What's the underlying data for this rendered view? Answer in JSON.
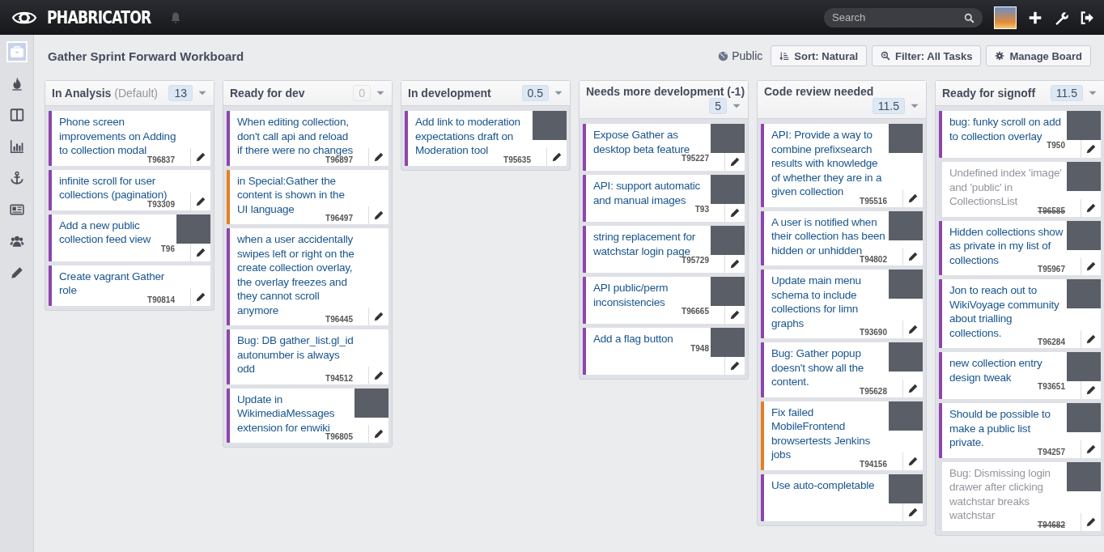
{
  "topbar": {
    "logo": "PHABRICATOR",
    "search": {
      "placeholder": "Search"
    }
  },
  "sidebar": {
    "items": [
      {
        "selected": true
      },
      {
        "selected": false
      },
      {
        "selected": false
      },
      {
        "selected": false
      },
      {
        "selected": false
      },
      {
        "selected": false
      },
      {
        "selected": false
      },
      {
        "selected": false
      }
    ]
  },
  "board": {
    "title": "Gather Sprint Forward Workboard",
    "visibility": "Public",
    "buttons": [
      {
        "label": "Sort: Natural"
      },
      {
        "label": "Filter: All Tasks"
      },
      {
        "label": "Manage Board"
      }
    ],
    "columns": [
      {
        "name": "In Analysis",
        "note": "(Default)",
        "count": "13",
        "count_active": true,
        "cards": [
          {
            "title": "Phone screen improvements on Adding to collection modal",
            "id": "T96837",
            "color": "#8e44ad",
            "closed": false,
            "avatar": false
          },
          {
            "title": "infinite scroll for user collections (pagination)",
            "id": "T93309",
            "color": "#8e44ad",
            "closed": false,
            "avatar": false
          },
          {
            "title": "Add a new public collection feed view",
            "id": "T96",
            "color": "#8e44ad",
            "closed": false,
            "avatar": true
          },
          {
            "title": "Create vagrant Gather role",
            "id": "T90814",
            "color": "#8e44ad",
            "closed": false,
            "avatar": false
          }
        ]
      },
      {
        "name": "Ready for dev",
        "count": "0",
        "count_active": false,
        "cards": [
          {
            "title": "When editing collection, don't call api and reload if there were no changes",
            "id": "T96897",
            "color": "#8e44ad",
            "closed": false,
            "avatar": false
          },
          {
            "title": "in Special:Gather the content is shown in the UI language",
            "id": "T96497",
            "color": "#e67e22",
            "closed": false,
            "avatar": false
          },
          {
            "title": "when a user accidentally swipes left or right on the create collection overlay, the overlay freezes and they cannot scroll anymore",
            "id": "T96445",
            "color": "#8e44ad",
            "closed": false,
            "avatar": false
          },
          {
            "title": "Bug: DB gather_list.gl_id autonumber is always odd",
            "id": "T94512",
            "color": "#8e44ad",
            "closed": false,
            "avatar": false
          },
          {
            "title": "Update in WikimediaMessages extension for enwiki",
            "id": "T96805",
            "color": "#8e44ad",
            "closed": false,
            "avatar": true
          }
        ]
      },
      {
        "name": "In development",
        "count": "0.5",
        "count_active": true,
        "cards": [
          {
            "title": "Add link to moderation expectations draft on Moderation tool",
            "id": "T95635",
            "color": "#8e44ad",
            "closed": false,
            "avatar": true
          }
        ]
      },
      {
        "name": "Needs more development (-1)",
        "count": "5",
        "count_active": true,
        "cards": [
          {
            "title": "Expose Gather as desktop beta feature",
            "id": "T95227",
            "color": "#8e44ad",
            "closed": false,
            "avatar": true
          },
          {
            "title": "API: support automatic and manual images",
            "id": "T93",
            "color": "#8e44ad",
            "closed": false,
            "avatar": true
          },
          {
            "title": "string replacement for watchstar login page",
            "id": "T95729",
            "color": "#8e44ad",
            "closed": false,
            "avatar": true
          },
          {
            "title": "API public/perm inconsistencies",
            "id": "T96665",
            "color": "#8e44ad",
            "closed": false,
            "avatar": true
          },
          {
            "title": "Add a flag button",
            "id": "T948",
            "color": "#8e44ad",
            "closed": false,
            "avatar": true
          }
        ]
      },
      {
        "name": "Code review needed",
        "count": "11.5",
        "count_active": true,
        "cards": [
          {
            "title": "API: Provide a way to combine prefixsearch results with knowledge of whether they are in a given collection",
            "id": "T95516",
            "color": "#8e44ad",
            "closed": false,
            "avatar": true
          },
          {
            "title": "A user is notified when their collection has been hidden or unhidden",
            "id": "T94802",
            "color": "#8e44ad",
            "closed": false,
            "avatar": true
          },
          {
            "title": "Update main menu schema to include collections for limn graphs",
            "id": "T93690",
            "color": "#8e44ad",
            "closed": false,
            "avatar": true
          },
          {
            "title": "Bug: Gather popup doesn't show all the content.",
            "id": "T95628",
            "color": "#8e44ad",
            "closed": false,
            "avatar": true
          },
          {
            "title": "Fix failed MobileFrontend browsertests Jenkins jobs",
            "id": "T94156",
            "color": "#e67e22",
            "closed": false,
            "avatar": true
          },
          {
            "title": "Use auto-completable",
            "color": "#8e44ad",
            "closed": false,
            "avatar": true
          }
        ]
      },
      {
        "name": "Ready for signoff",
        "count": "11.5",
        "count_active": true,
        "cards": [
          {
            "title": "bug: funky scroll on add to collection overlay",
            "id": "T950",
            "color": "#8e44ad",
            "closed": false,
            "avatar": true
          },
          {
            "title": "Undefined index 'image' and 'public' in CollectionsList",
            "id": "T96585",
            "color": "#dcdfe5",
            "closed": true,
            "avatar": true
          },
          {
            "title": "Hidden collections show as private in my list of collections",
            "id": "T95967",
            "color": "#8e44ad",
            "closed": false,
            "avatar": true
          },
          {
            "title": "Jon to reach out to WikiVoyage community about trialling collections.",
            "id": "T96284",
            "color": "#8e44ad",
            "closed": false,
            "avatar": true
          },
          {
            "title": "new collection entry design tweak",
            "id": "T93651",
            "color": "#8e44ad",
            "closed": false,
            "avatar": true
          },
          {
            "title": "Should be possible to make a public list private.",
            "id": "T94257",
            "color": "#8e44ad",
            "closed": false,
            "avatar": true
          },
          {
            "title": "Bug: Dismissing login drawer after clicking watchstar breaks watchstar",
            "id": "T94682",
            "color": "#dcdfe5",
            "closed": true,
            "avatar": true
          }
        ]
      }
    ]
  }
}
